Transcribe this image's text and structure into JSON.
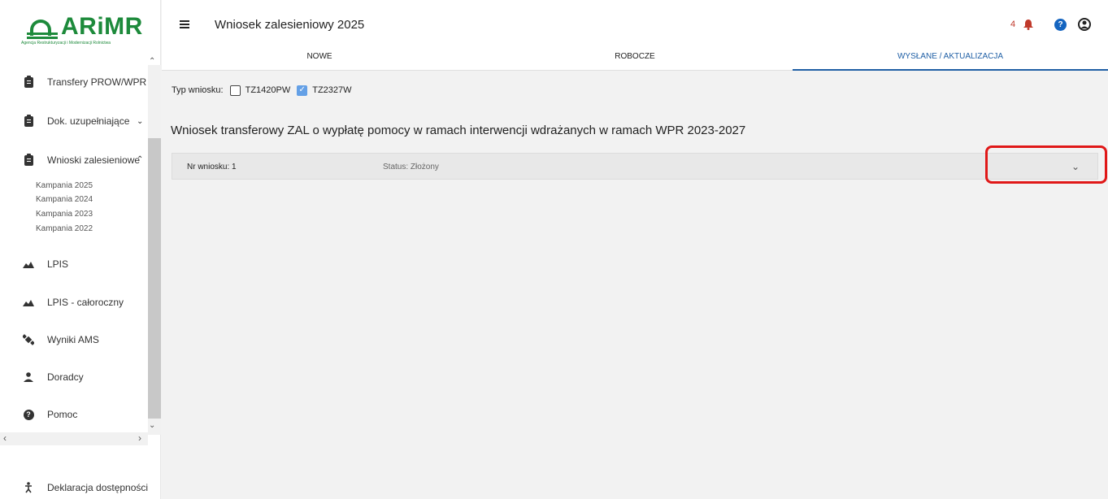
{
  "logo": {
    "text": "ARiMR",
    "subtitle": "Agencja Restrukturyzacji i Modernizacji Rolnictwa"
  },
  "sidebar": {
    "items": [
      {
        "label": "Transfery PROW/WPR",
        "icon": "clipboard-icon"
      },
      {
        "label": "Dok. uzupełniające",
        "icon": "clipboard-icon",
        "chevron": "v"
      },
      {
        "label": "Wnioski zalesieniowe",
        "icon": "clipboard-icon",
        "chevron": "^"
      },
      {
        "label": "LPIS",
        "icon": "terrain-icon"
      },
      {
        "label": "LPIS - całoroczny",
        "icon": "terrain-icon"
      },
      {
        "label": "Wyniki AMS",
        "icon": "satellite-icon"
      },
      {
        "label": "Doradcy",
        "icon": "person-icon"
      },
      {
        "label": "Pomoc",
        "icon": "help-circle-icon"
      }
    ],
    "subitems": [
      "Kampania 2025",
      "Kampania 2024",
      "Kampania 2023",
      "Kampania 2022"
    ],
    "footer": {
      "label": "Deklaracja dostępności",
      "icon": "accessibility-icon"
    }
  },
  "header": {
    "title": "Wniosek zalesieniowy 2025",
    "notification_count": "4",
    "help_label": "?"
  },
  "tabs": [
    {
      "label": "NOWE",
      "active": false
    },
    {
      "label": "ROBOCZE",
      "active": false
    },
    {
      "label": "WYSŁANE / AKTUALIZACJA",
      "active": true
    }
  ],
  "filter": {
    "label": "Typ wniosku:",
    "options": [
      {
        "label": "TZ1420PW",
        "checked": false
      },
      {
        "label": "TZ2327W",
        "checked": true
      }
    ]
  },
  "section": {
    "title": "Wniosek transferowy ZAL o wypłatę pomocy w ramach interwencji wdrażanych w ramach WPR 2023-2027"
  },
  "application": {
    "number_label": "Nr wniosku: 1",
    "status_label": "Status: Złożony"
  },
  "colors": {
    "brand": "#1d8a3b",
    "accent": "#1f5fa5",
    "highlight": "#e01818",
    "notification": "#c0392b"
  }
}
